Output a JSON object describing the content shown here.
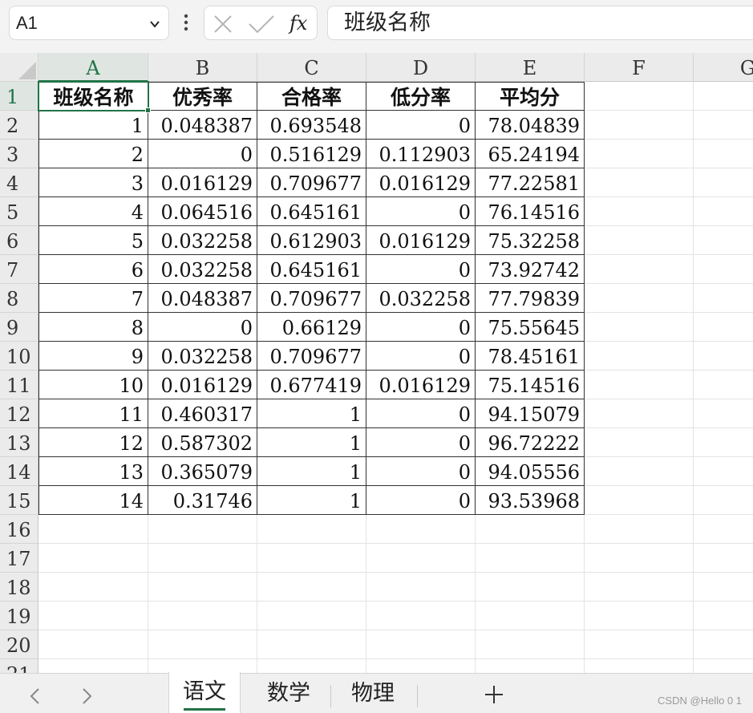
{
  "formula_bar": {
    "name_box": "A1",
    "formula_text": "班级名称",
    "icons": [
      "cancel-icon",
      "confirm-icon",
      "fx-icon"
    ]
  },
  "columns": [
    "A",
    "B",
    "C",
    "D",
    "E",
    "F",
    "G"
  ],
  "rows": [
    "1",
    "2",
    "3",
    "4",
    "5",
    "6",
    "7",
    "8",
    "9",
    "10",
    "11",
    "12",
    "13",
    "14",
    "15",
    "16",
    "17",
    "18",
    "19",
    "20",
    "21"
  ],
  "table": {
    "headers": [
      "班级名称",
      "优秀率",
      "合格率",
      "低分率",
      "平均分"
    ],
    "data": [
      [
        "1",
        "0.048387",
        "0.693548",
        "0",
        "78.04839"
      ],
      [
        "2",
        "0",
        "0.516129",
        "0.112903",
        "65.24194"
      ],
      [
        "3",
        "0.016129",
        "0.709677",
        "0.016129",
        "77.22581"
      ],
      [
        "4",
        "0.064516",
        "0.645161",
        "0",
        "76.14516"
      ],
      [
        "5",
        "0.032258",
        "0.612903",
        "0.016129",
        "75.32258"
      ],
      [
        "6",
        "0.032258",
        "0.645161",
        "0",
        "73.92742"
      ],
      [
        "7",
        "0.048387",
        "0.709677",
        "0.032258",
        "77.79839"
      ],
      [
        "8",
        "0",
        "0.66129",
        "0",
        "75.55645"
      ],
      [
        "9",
        "0.032258",
        "0.709677",
        "0",
        "78.45161"
      ],
      [
        "10",
        "0.016129",
        "0.677419",
        "0.016129",
        "75.14516"
      ],
      [
        "11",
        "0.460317",
        "1",
        "0",
        "94.15079"
      ],
      [
        "12",
        "0.587302",
        "1",
        "0",
        "96.72222"
      ],
      [
        "13",
        "0.365079",
        "1",
        "0",
        "94.05556"
      ],
      [
        "14",
        "0.31746",
        "1",
        "0",
        "93.53968"
      ]
    ]
  },
  "sheet_tabs": [
    {
      "label": "语文",
      "active": true
    },
    {
      "label": "数学",
      "active": false
    },
    {
      "label": "物理",
      "active": false
    }
  ],
  "tab_nav": {
    "prev_icon": "chevron-left-icon",
    "next_icon": "chevron-right-icon",
    "add_icon": "plus-icon"
  },
  "watermark": "CSDN @Hello 0 1",
  "colors": {
    "accent": "#217346",
    "header_bg": "#ebebeb",
    "gridline": "#e3e3e3"
  }
}
